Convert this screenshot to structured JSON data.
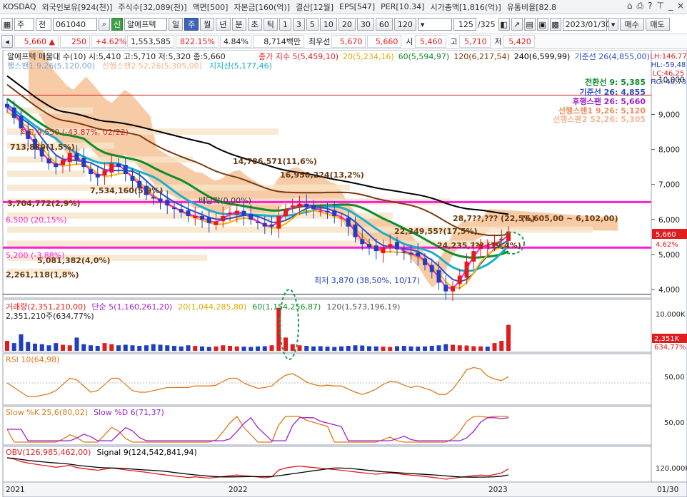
{
  "top_info": {
    "items": [
      "KOSDAQ",
      "외국인보유[924(천)]",
      "주식수[32,089(천)]",
      "액면[500]",
      "자본금[160(억)]",
      "결산[12월]",
      "EPS[547]",
      "PER[10.34]",
      "시가총액[1,816(억)]",
      "유통비율[82.8"
    ],
    "icons": [
      "home-icon",
      "print-icon",
      "help-icon",
      "pin-icon",
      "minimize-icon",
      "close-icon"
    ]
  },
  "toolbar": {
    "mode": "주",
    "prefix": "전",
    "code": "061040",
    "alpha_tag": "신",
    "name": "알에프텍",
    "periods": [
      "일",
      "주",
      "월",
      "년",
      "분",
      "초",
      "틱"
    ],
    "active_period": "주",
    "intervals": [
      "1",
      "3",
      "5",
      "10",
      "20",
      "30",
      "60",
      "120"
    ],
    "count": "125",
    "total": "/325",
    "date": "2023/01/30",
    "buy_label": "매수",
    "sell_label": "매도"
  },
  "quote": {
    "price": "5,660",
    "arrow": "▲",
    "change": "250",
    "change_pct": "+4.62%",
    "volume": "1,553,585",
    "vol_ratio": "822.15%",
    "turnover": "4.84%",
    "amount": "8,714백만",
    "preferred_label": "최우선",
    "ask": "5,670",
    "bid": "5,660",
    "open_label": "시",
    "open": "5,460",
    "high_label": "고",
    "high": "5,710",
    "low_label": "저",
    "low": "5,420"
  },
  "main_legend": {
    "line1": "알에프텍 매물대 수(10)  시:5,410 고:5,710 저:5,320 종:5,660",
    "ma_title": "종가 지수 5(5,459,10)",
    "ma20": "20(5,234,16)",
    "ma60": "60(5,594,97)",
    "ma120": "120(6,217,54)",
    "ma240": "240(6,599,99)",
    "kijun": "기준선 26(4,855,00)",
    "line2a": "행스팬1 9,26(5,120,00)",
    "line2b": "선행스팬2 52,26(5,305,00)",
    "line2c": "지지선(5,177,46)"
  },
  "ichimoku_box": {
    "l1": "전환선 9: 5,385",
    "l2": "기준선 26: 4,855",
    "l3": "후행스팬 26: 5,660",
    "l4": "선행스팬1 9,26: 5,120",
    "l5": "선행스팬2 52,26: 5,305"
  },
  "right_stats": [
    "LH:146,77",
    "HL:-59,48",
    "LC:46,25",
    "HC:-40,73"
  ],
  "annotations": {
    "high": "최고 9,550 (-43.87%, 02/22)",
    "vp1": "713,839(1,5%)",
    "vp2": "14,786,571(11,6%)",
    "vp3": "16,950,224(13,2%)",
    "vp4": "7,534,160(5,9%)",
    "vp5": "3,704,772(2,9%)",
    "dividend": "배당락(0,00%)",
    "line6500": "6,500 (20,15%)",
    "line5200": "5,200 (-3,88%)",
    "vp6": "5,081,382(4,0%)",
    "vp7": "22,349,55?(17,5%)",
    "vp8": "2,261,118(1,8%)",
    "vp9": "24,235,??? (19,4%)",
    "vp10": "28,7??,??? (22,5%)",
    "range_label": "(6,605,00 ~ 6,102,00)",
    "low": "최저 3,870 (38,50%, 10/17)"
  },
  "price_axis": [
    "10,000",
    "9,000",
    "8,000",
    "7,000",
    "6,000",
    "5,000",
    "4,000"
  ],
  "price_badges": {
    "current": "5,660",
    "pct": "4,62%"
  },
  "volume_panel": {
    "legend_title": "거래량(2,351,210,00)",
    "ma5": "단순 5(1,160,261,20)",
    "ma20": "20(1,044,285,80)",
    "ma60": "60(1,154,256,87)",
    "ma120": "120(1,573,196,19)",
    "sub": "2,351,210주(634,77%)",
    "axis": "10,000K",
    "badge": "2,351K",
    "badge_pct": "634,77%"
  },
  "rsi_panel": {
    "legend": "RSI 10(64,98)",
    "axis": "50,00"
  },
  "slow_panel": {
    "k": "Slow %K 25,6(80,02)",
    "d": "Slow %D 6(71,37)",
    "axis": "50,00"
  },
  "obv_panel": {
    "obv": "OBV(126,985,462,00)",
    "signal": "Signal 9(124,542,841,94)",
    "axis": "120,000K"
  },
  "time_axis": {
    "y2021": "2021",
    "y2022": "2022",
    "y2023": "2023",
    "current": "01/30"
  },
  "colors": {
    "up": "#e01c1c",
    "down": "#1f3fbf",
    "magenta": "#ff1ed8",
    "cloud": "#f5b98a",
    "ma120": "#0f8c2a",
    "ma240": "#7a3a12"
  },
  "chart_data": {
    "type": "candlestick",
    "range_y": [
      3800,
      10800
    ],
    "weekly_close": [
      9200,
      8900,
      8600,
      8300,
      8000,
      7800,
      7600,
      7500,
      7700,
      7900,
      7700,
      7500,
      7300,
      7200,
      7400,
      7600,
      7500,
      7300,
      7100,
      6900,
      6700,
      6600,
      6500,
      6400,
      6300,
      6200,
      6100,
      6100,
      6000,
      5900,
      5950,
      6100,
      6200,
      6250,
      6100,
      6000,
      5900,
      5800,
      5800,
      6100,
      6300,
      6400,
      6450,
      6350,
      6300,
      6250,
      6200,
      6100,
      6050,
      5800,
      5500,
      5300,
      5200,
      5100,
      5200,
      5300,
      5150,
      5050,
      5000,
      4950,
      4700,
      4500,
      4200,
      3950,
      4100,
      4400,
      4800,
      5100,
      5300,
      5250,
      5350,
      5450,
      5660
    ],
    "volume_k": [
      900,
      700,
      1500,
      800,
      650,
      600,
      500,
      700,
      550,
      500,
      1200,
      600,
      500,
      450,
      700,
      600,
      500,
      550,
      500,
      450,
      500,
      600,
      550,
      500,
      450,
      400,
      500,
      450,
      400,
      350,
      400,
      500,
      450,
      400,
      380,
      350,
      400,
      420,
      500,
      3900,
      1200,
      600,
      500,
      450,
      400,
      420,
      380,
      350,
      400,
      450,
      500,
      480,
      420,
      400,
      380,
      350,
      420,
      450,
      400,
      380,
      400,
      450,
      500,
      600,
      550,
      500,
      480,
      420,
      400,
      380,
      700,
      900,
      2351
    ],
    "levels": {
      "high": 9550,
      "line_upper": 6500,
      "line_lower": 5200,
      "low": 3870
    }
  }
}
